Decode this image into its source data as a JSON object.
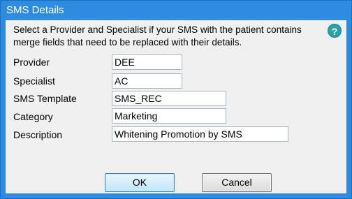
{
  "window": {
    "title": "SMS Details"
  },
  "intro": "Select a Provider and Specialist if your SMS with the patient contains merge fields that need to be replaced with their details.",
  "help_icon": "?",
  "fields": {
    "provider": {
      "label": "Provider",
      "value": "DEE"
    },
    "specialist": {
      "label": "Specialist",
      "value": "AC"
    },
    "template": {
      "label": "SMS Template",
      "value": "SMS_REC"
    },
    "category": {
      "label": "Category",
      "value": "Marketing"
    },
    "description": {
      "label": "Description",
      "value": "Whitening Promotion by SMS"
    }
  },
  "buttons": {
    "ok": "OK",
    "cancel": "Cancel"
  },
  "colors": {
    "titlebar": "#2f8be0",
    "client": "#f0f0f0",
    "help": "#26a3a7"
  }
}
